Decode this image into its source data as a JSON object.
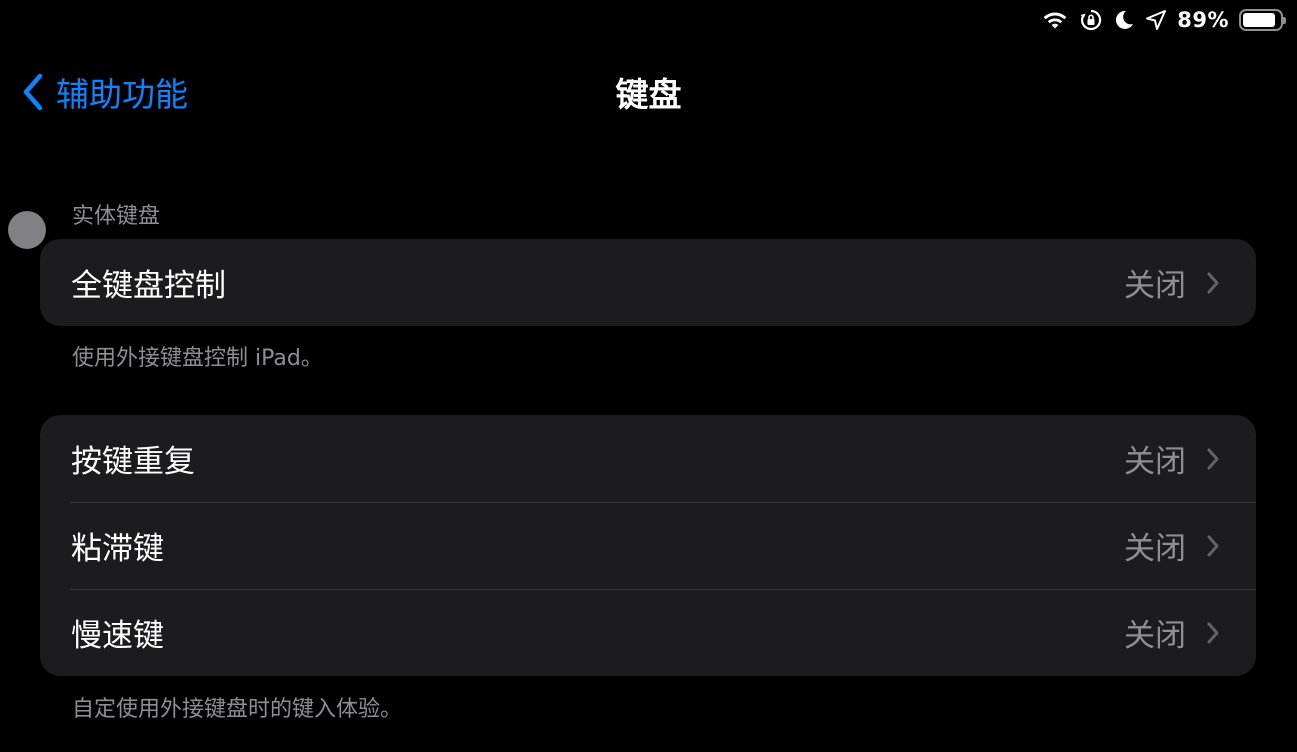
{
  "status_bar": {
    "battery_percent": "89%",
    "battery_level": 0.89,
    "icons": [
      "wifi-icon",
      "orientation-lock-icon",
      "moon-icon",
      "location-icon",
      "battery-icon"
    ]
  },
  "nav": {
    "back_label": "辅助功能",
    "title": "键盘"
  },
  "sections": [
    {
      "header": "实体键盘",
      "rows": [
        {
          "label": "全键盘控制",
          "value": "关闭"
        }
      ],
      "footer": "使用外接键盘控制 iPad。"
    },
    {
      "header": "",
      "rows": [
        {
          "label": "按键重复",
          "value": "关闭"
        },
        {
          "label": "粘滞键",
          "value": "关闭"
        },
        {
          "label": "慢速键",
          "value": "关闭"
        }
      ],
      "footer": "自定使用外接键盘时的键入体验。"
    }
  ],
  "colors": {
    "accent": "#0a84ff",
    "background": "#000000",
    "cell_background": "#1c1c1e",
    "secondary_text": "#8e8e93"
  }
}
